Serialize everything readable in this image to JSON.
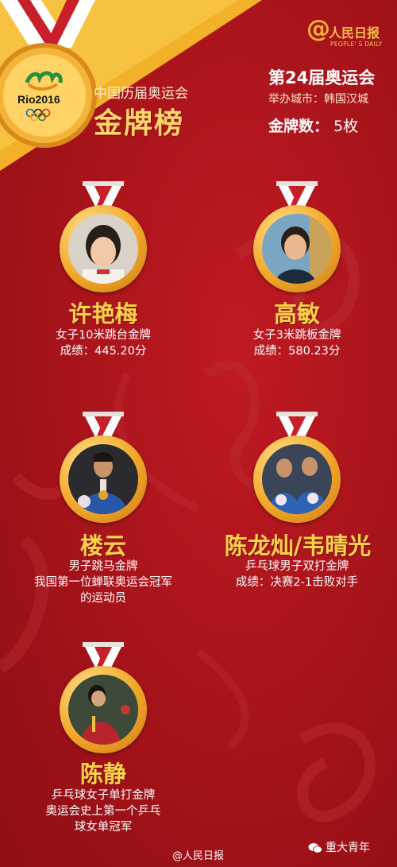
{
  "brand": {
    "name": "人民日报",
    "en": "PEOPLE' S DAILY"
  },
  "logo": {
    "text": "Rio2016"
  },
  "header": {
    "subtitle": "中国历届奥运会",
    "title": "金牌榜"
  },
  "games": {
    "title": "第24届奥运会",
    "city": "举办城市：韩国汉城",
    "medal_label": "金牌数：",
    "medal_count": "5枚"
  },
  "athletes": [
    {
      "name": "许艳梅",
      "lines": [
        "女子10米跳台金牌",
        "成绩：445.20分"
      ],
      "photo": "portrait-young-woman"
    },
    {
      "name": "高敏",
      "lines": [
        "女子3米跳板金牌",
        "成绩：580.23分"
      ],
      "photo": "portrait-smiling-diver"
    },
    {
      "name": "楼云",
      "lines": [
        "男子跳马金牌",
        "我国第一位蝉联奥运会冠军",
        "的运动员"
      ],
      "photo": "gymnast-with-flowers"
    },
    {
      "name": "陈龙灿/韦晴光",
      "lines": [
        "乒乓球男子双打金牌",
        "成绩：决赛2-1击败对手"
      ],
      "photo": "two-players-with-flowers"
    },
    {
      "name": "陈静",
      "lines": [
        "乒乓球女子单打金牌",
        "奥运会史上第一个乒乓",
        "球女单冠军"
      ],
      "photo": "table-tennis-player"
    }
  ],
  "footer": {
    "weibo": "@人民日报",
    "wechat": "重大青年"
  },
  "colors": {
    "background": "#a8141c",
    "gold": "#ffd24a",
    "accent": "#f2a82a"
  }
}
